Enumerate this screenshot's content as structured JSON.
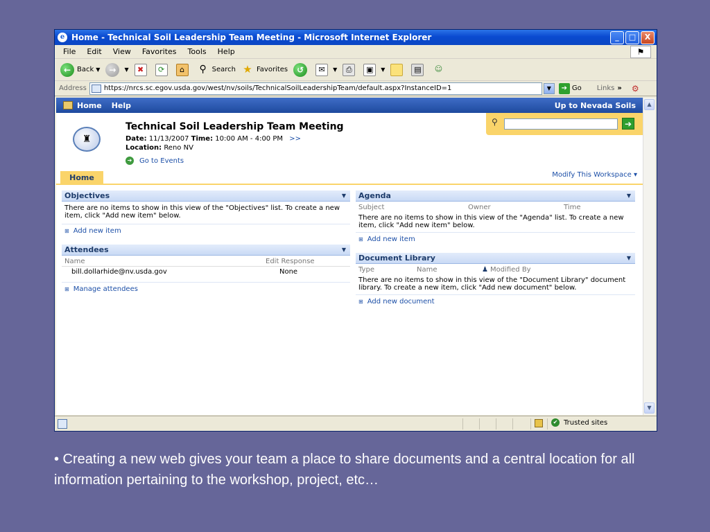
{
  "window": {
    "title": "Home - Technical Soil Leadership Team Meeting - Microsoft Internet Explorer",
    "min": "_",
    "max": "□",
    "close": "X"
  },
  "menu": [
    "File",
    "Edit",
    "View",
    "Favorites",
    "Tools",
    "Help"
  ],
  "toolbar": {
    "back": "Back",
    "search": "Search",
    "favorites": "Favorites"
  },
  "address": {
    "label": "Address",
    "url": "https://nrcs.sc.egov.usda.gov/west/nv/soils/TechnicalSoilLeadershipTeam/default.aspx?InstanceID=1",
    "go": "Go",
    "links": "Links",
    "links_more": "»"
  },
  "topnav": {
    "home": "Home",
    "help": "Help",
    "up": "Up to Nevada Soils"
  },
  "site": {
    "title": "Technical Soil Leadership Team Meeting",
    "date_label": "Date:",
    "date": "11/13/2007",
    "time_label": "Time:",
    "time": "10:00 AM - 4:00 PM",
    "more": ">>",
    "location_label": "Location:",
    "location": "Reno NV",
    "goto_events": "Go to Events"
  },
  "tabs": {
    "home": "Home",
    "modify": "Modify This Workspace ▾"
  },
  "objectives": {
    "title": "Objectives",
    "empty": "There are no items to show in this view of the \"Objectives\" list. To create a new item, click \"Add new item\" below.",
    "add": "Add new item"
  },
  "attendees": {
    "title": "Attendees",
    "col_name": "Name",
    "col_response": "Edit Response",
    "rows": [
      {
        "name": "bill.dollarhide@nv.usda.gov",
        "response": "None"
      }
    ],
    "manage": "Manage attendees"
  },
  "agenda": {
    "title": "Agenda",
    "col_subject": "Subject",
    "col_owner": "Owner",
    "col_time": "Time",
    "empty": "There are no items to show in this view of the \"Agenda\" list. To create a new item, click \"Add new item\" below.",
    "add": "Add new item"
  },
  "doclib": {
    "title": "Document Library",
    "col_type": "Type",
    "col_name": "Name",
    "col_modified": "Modified By",
    "empty": "There are no items to show in this view of the \"Document Library\" document library. To create a new item, click \"Add new document\" below.",
    "add": "Add new document"
  },
  "status": {
    "zone": "Trusted sites"
  },
  "caption": "• Creating a new web gives your team a place to share documents and a central location for all information pertaining to the workshop, project, etc…"
}
